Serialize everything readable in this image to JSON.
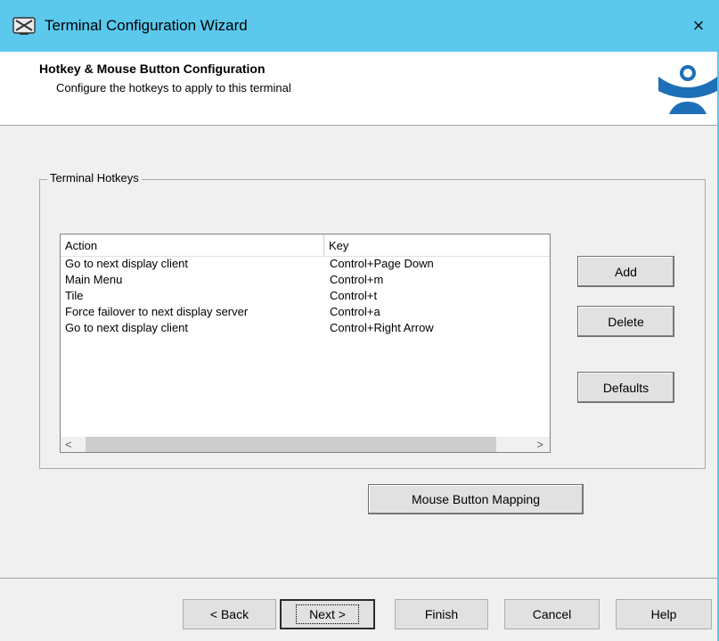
{
  "window": {
    "title": "Terminal Configuration Wizard",
    "close_label": "×",
    "icon": "terminal-app-icon",
    "accent_color": "#5bc8ec"
  },
  "header": {
    "title": "Hotkey & Mouse Button Configuration",
    "subtitle": "Configure the hotkeys to apply to this terminal",
    "logo_icon": "thinmanager-logo-icon"
  },
  "hotkeys_group": {
    "legend": "Terminal Hotkeys",
    "columns": {
      "action": "Action",
      "key": "Key"
    },
    "rows": [
      {
        "action": "Go to next display client",
        "key": "Control+Page Down"
      },
      {
        "action": "Main Menu",
        "key": "Control+m"
      },
      {
        "action": "Tile",
        "key": "Control+t"
      },
      {
        "action": "Force failover to next display server",
        "key": "Control+a"
      },
      {
        "action": "Go to next display client",
        "key": "Control+Right Arrow"
      }
    ],
    "scroll_left": "<",
    "scroll_right": ">",
    "buttons": {
      "add": "Add",
      "delete": "Delete",
      "defaults": "Defaults"
    }
  },
  "mouse_mapping_button": "Mouse Button Mapping",
  "footer": {
    "back": "< Back",
    "next": "Next >",
    "finish": "Finish",
    "cancel": "Cancel",
    "help": "Help"
  }
}
